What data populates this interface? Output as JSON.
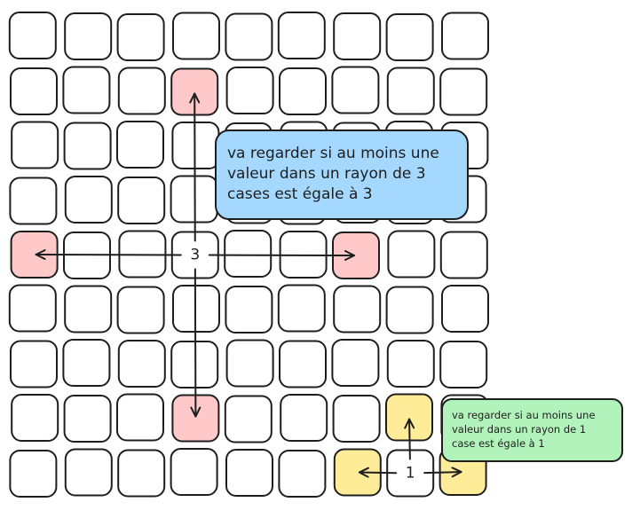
{
  "grid": {
    "rows": 9,
    "cols": 9,
    "colors": {
      "empty": "#ffffff",
      "pink": "#ffc9c9",
      "yellow": "#ffec99",
      "stroke": "#1e1e1e"
    },
    "highlighted_cells": [
      {
        "row": 1,
        "col": 3,
        "fill": "pink"
      },
      {
        "row": 4,
        "col": 0,
        "fill": "pink"
      },
      {
        "row": 4,
        "col": 6,
        "fill": "pink"
      },
      {
        "row": 7,
        "col": 3,
        "fill": "pink"
      },
      {
        "row": 7,
        "col": 7,
        "fill": "yellow"
      },
      {
        "row": 8,
        "col": 6,
        "fill": "yellow"
      },
      {
        "row": 8,
        "col": 8,
        "fill": "yellow"
      }
    ],
    "labeled_cells": [
      {
        "row": 4,
        "col": 3,
        "label": "3"
      },
      {
        "row": 8,
        "col": 7,
        "label": "1"
      }
    ]
  },
  "arrows": [
    {
      "from": [
        4,
        3
      ],
      "to": [
        1,
        3
      ]
    },
    {
      "from": [
        4,
        3
      ],
      "to": [
        7,
        3
      ]
    },
    {
      "from": [
        4,
        3
      ],
      "to": [
        4,
        0
      ]
    },
    {
      "from": [
        4,
        3
      ],
      "to": [
        4,
        6
      ]
    },
    {
      "from": [
        8,
        7
      ],
      "to": [
        7,
        7
      ]
    },
    {
      "from": [
        8,
        7
      ],
      "to": [
        8,
        6
      ]
    },
    {
      "from": [
        8,
        7
      ],
      "to": [
        8,
        8
      ]
    }
  ],
  "callouts": {
    "blue": {
      "text": "va regarder si au moins une valeur dans un rayon de 3 cases est égale à 3",
      "color": "#a5d8ff"
    },
    "green": {
      "text": "va regarder si au moins une valeur dans un rayon de 1 case est égale à 1",
      "color": "#b2f2bb"
    }
  }
}
